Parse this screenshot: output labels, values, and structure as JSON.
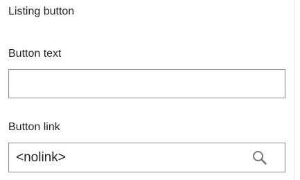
{
  "section": {
    "title": "Listing button"
  },
  "fields": {
    "button_text": {
      "label": "Button text",
      "value": ""
    },
    "button_link": {
      "label": "Button link",
      "value": "<nolink>",
      "action_icon": "search-icon"
    }
  },
  "colors": {
    "text": "#222222",
    "input_border": "#8a8a8a",
    "icon": "#777777"
  }
}
